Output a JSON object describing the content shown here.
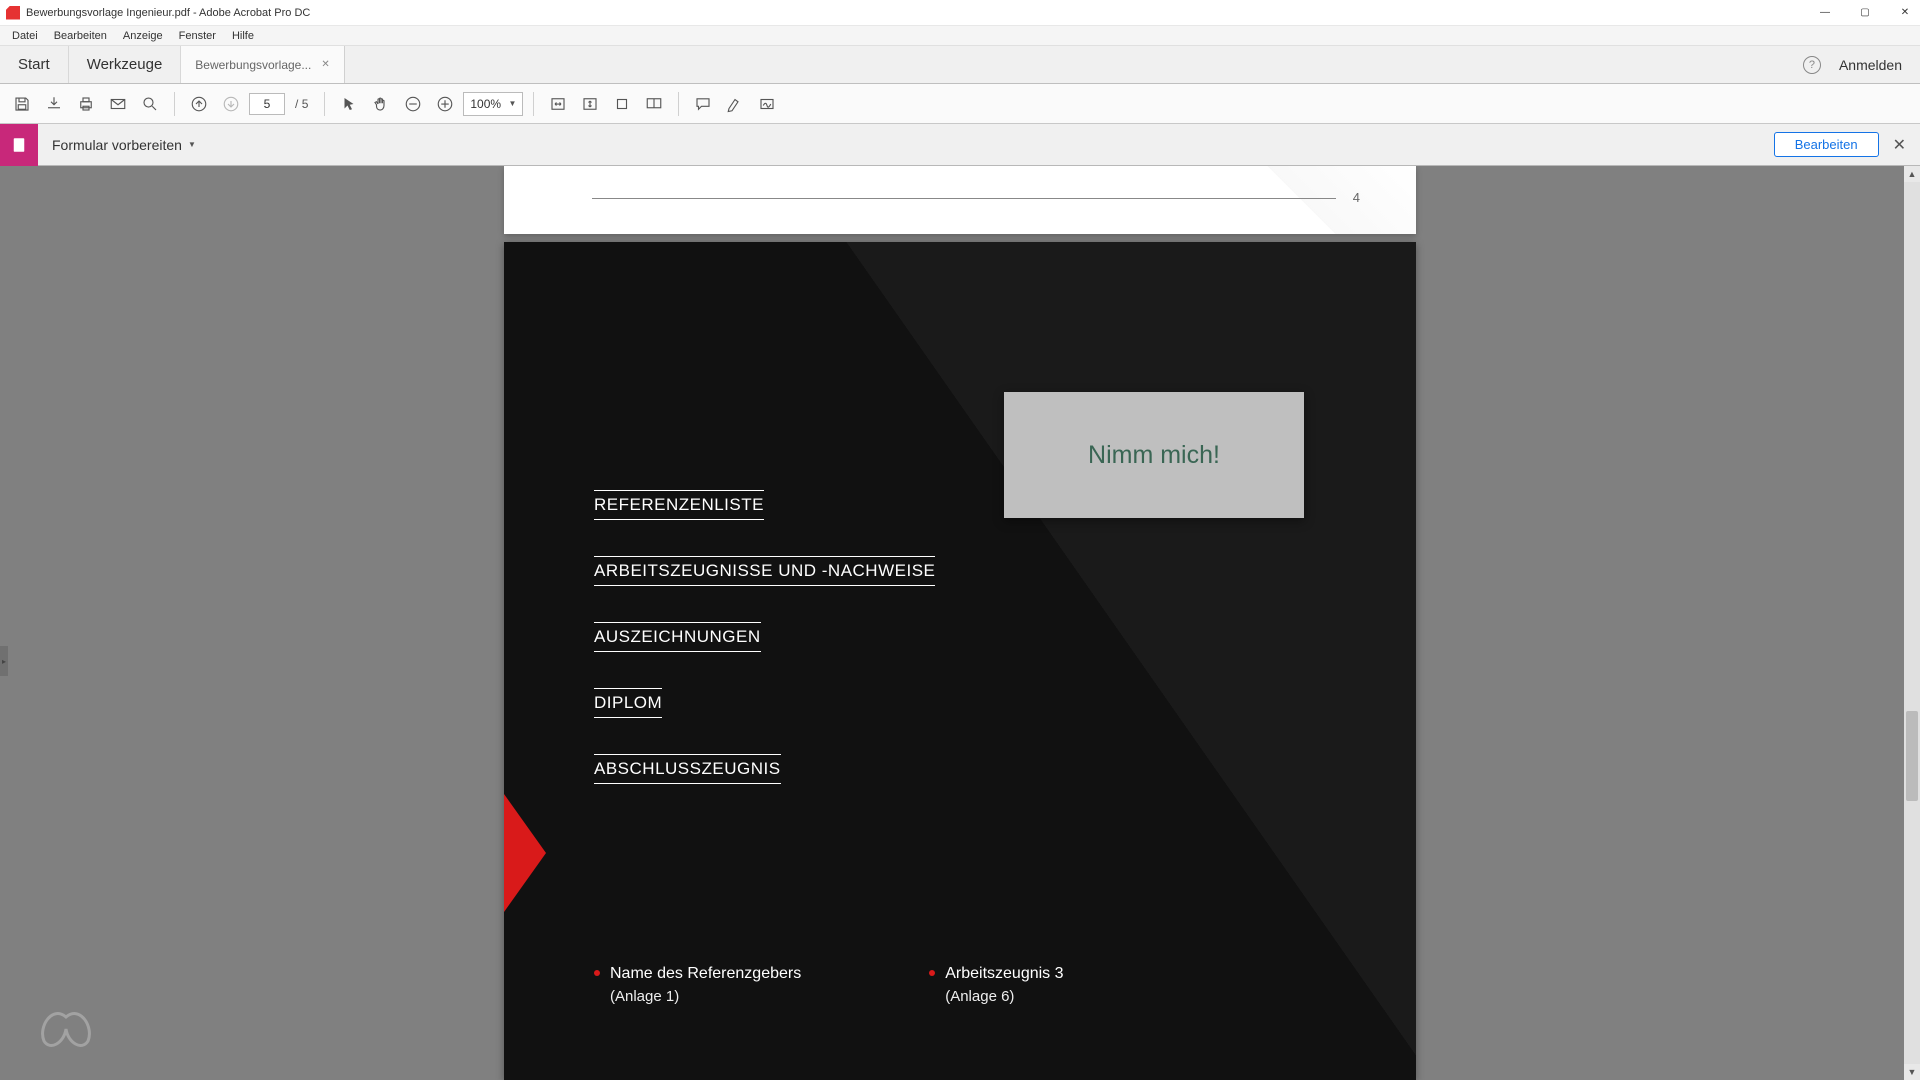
{
  "window": {
    "title": "Bewerbungsvorlage Ingenieur.pdf - Adobe Acrobat Pro DC"
  },
  "menu": {
    "items": [
      "Datei",
      "Bearbeiten",
      "Anzeige",
      "Fenster",
      "Hilfe"
    ]
  },
  "tabs": {
    "start": "Start",
    "tools": "Werkzeuge",
    "document": "Bewerbungsvorlage...",
    "sign_in": "Anmelden"
  },
  "toolbar": {
    "page_current": "5",
    "page_sep": "/",
    "page_total": "5",
    "zoom_value": "100%"
  },
  "modebar": {
    "label": "Formular vorbereiten",
    "edit_button": "Bearbeiten"
  },
  "page_prev": {
    "number": "4"
  },
  "callout": {
    "text": "Nimm mich!"
  },
  "sections": [
    "REFERENZENLISTE",
    "ARBEITSZEUGNISSE UND -NACHWEISE",
    "AUSZEICHNUNGEN",
    "DIPLOM",
    "ABSCHLUSSZEUGNIS"
  ],
  "refs_left": {
    "title": "Name des Referenzgebers",
    "sub": "(Anlage 1)"
  },
  "refs_right": {
    "title": "Arbeitszeugnis 3",
    "sub": "(Anlage 6)"
  }
}
